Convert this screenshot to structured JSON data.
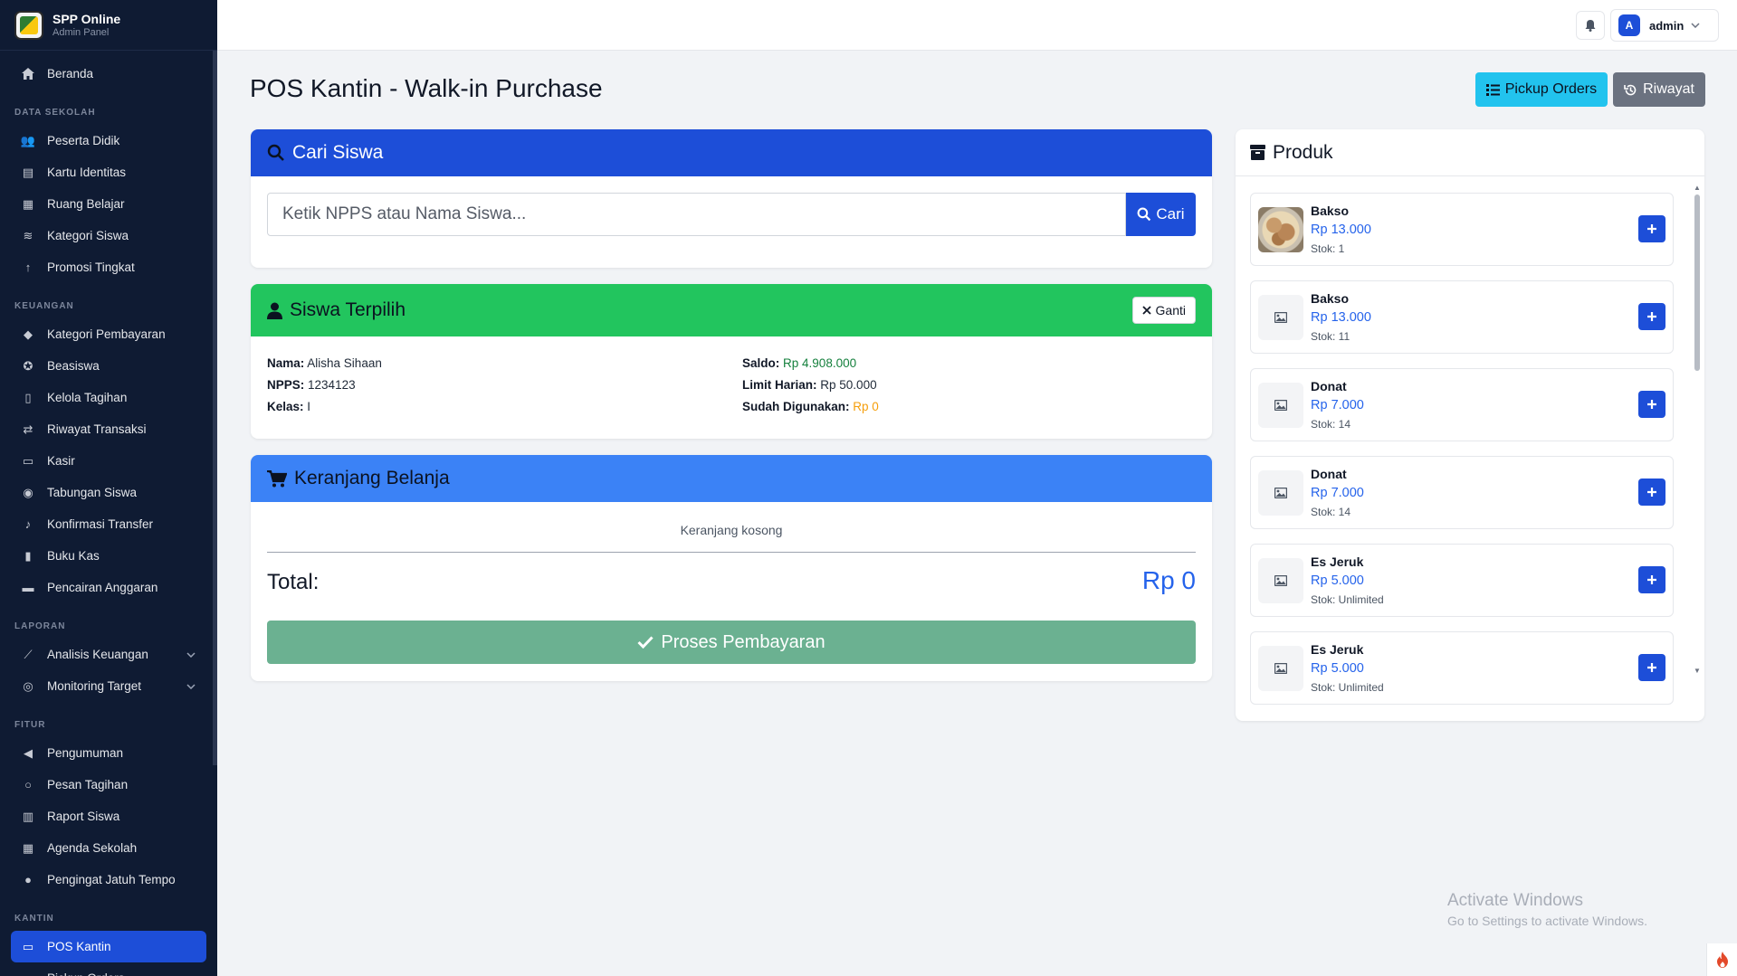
{
  "brand": {
    "title": "SPP Online",
    "subtitle": "Admin Panel"
  },
  "sidebar": {
    "home": {
      "label": "Beranda",
      "icon": "home-icon"
    },
    "sections": [
      {
        "title": "DATA SEKOLAH",
        "items": [
          {
            "label": "Peserta Didik",
            "icon": "users-icon"
          },
          {
            "label": "Kartu Identitas",
            "icon": "id-card-icon"
          },
          {
            "label": "Ruang Belajar",
            "icon": "school-icon"
          },
          {
            "label": "Kategori Siswa",
            "icon": "layers-icon"
          },
          {
            "label": "Promosi Tingkat",
            "icon": "arrow-up-icon"
          }
        ]
      },
      {
        "title": "KEUANGAN",
        "items": [
          {
            "label": "Kategori Pembayaran",
            "icon": "tags-icon"
          },
          {
            "label": "Beasiswa",
            "icon": "award-icon"
          },
          {
            "label": "Kelola Tagihan",
            "icon": "file-invoice-icon"
          },
          {
            "label": "Riwayat Transaksi",
            "icon": "exchange-icon"
          },
          {
            "label": "Kasir",
            "icon": "cash-register-icon"
          },
          {
            "label": "Tabungan Siswa",
            "icon": "piggy-bank-icon"
          },
          {
            "label": "Konfirmasi Transfer",
            "icon": "bell-icon"
          },
          {
            "label": "Buku Kas",
            "icon": "book-icon"
          },
          {
            "label": "Pencairan Anggaran",
            "icon": "wallet-icon"
          }
        ]
      },
      {
        "title": "LAPORAN",
        "items": [
          {
            "label": "Analisis Keuangan",
            "icon": "chart-line-icon",
            "expandable": true
          },
          {
            "label": "Monitoring Target",
            "icon": "target-icon",
            "expandable": true
          }
        ]
      },
      {
        "title": "FITUR",
        "items": [
          {
            "label": "Pengumuman",
            "icon": "bullhorn-icon"
          },
          {
            "label": "Pesan Tagihan",
            "icon": "whatsapp-icon"
          },
          {
            "label": "Raport Siswa",
            "icon": "open-book-icon"
          },
          {
            "label": "Agenda Sekolah",
            "icon": "calendar-icon"
          },
          {
            "label": "Pengingat Jatuh Tempo",
            "icon": "clock-icon"
          }
        ]
      },
      {
        "title": "KANTIN",
        "items": [
          {
            "label": "POS Kantin",
            "icon": "cash-register-icon",
            "active": true
          },
          {
            "label": "Pickup Orders",
            "icon": "shopping-bag-icon"
          }
        ]
      }
    ]
  },
  "topbar": {
    "user_initial": "A",
    "user_name": "admin"
  },
  "page": {
    "title": "POS Kantin - Walk-in Purchase",
    "pickup_btn": "Pickup Orders",
    "history_btn": "Riwayat"
  },
  "search": {
    "title": "Cari Siswa",
    "placeholder": "Ketik NPPS atau Nama Siswa...",
    "button": "Cari"
  },
  "student": {
    "title": "Siswa Terpilih",
    "change_btn": "Ganti",
    "name_label": "Nama:",
    "name": "Alisha Sihaan",
    "npps_label": "NPPS:",
    "npps": "1234123",
    "class_label": "Kelas:",
    "class": "I",
    "balance_label": "Saldo:",
    "balance": "Rp 4.908.000",
    "limit_label": "Limit Harian:",
    "limit": "Rp 50.000",
    "used_label": "Sudah Digunakan:",
    "used": "Rp 0",
    "colors": {
      "balance": "#15803d",
      "used": "#f59e0b"
    }
  },
  "cart": {
    "title": "Keranjang Belanja",
    "empty": "Keranjang kosong",
    "total_label": "Total:",
    "total_value": "Rp 0",
    "pay_btn": "Proses Pembayaran"
  },
  "products": {
    "title": "Produk",
    "items": [
      {
        "name": "Bakso",
        "price": "Rp 13.000",
        "stock": "Stok: 1",
        "image": "photo"
      },
      {
        "name": "Bakso",
        "price": "Rp 13.000",
        "stock": "Stok: 11",
        "image": "image-icon"
      },
      {
        "name": "Donat",
        "price": "Rp 7.000",
        "stock": "Stok: 14",
        "image": "image-icon"
      },
      {
        "name": "Donat",
        "price": "Rp 7.000",
        "stock": "Stok: 14",
        "image": "image-icon"
      },
      {
        "name": "Es Jeruk",
        "price": "Rp 5.000",
        "stock": "Stok: Unlimited",
        "image": "image-icon"
      },
      {
        "name": "Es Jeruk",
        "price": "Rp 5.000",
        "stock": "Stok: Unlimited",
        "image": "image-icon"
      }
    ]
  },
  "watermark": {
    "title": "Activate Windows",
    "subtitle": "Go to Settings to activate Windows."
  },
  "colors": {
    "primary": "#1d4ed8",
    "success": "#22c55e",
    "info": "#22c3ee",
    "sky": "#3b82f6",
    "sidebar_bg": "#0f1b33"
  }
}
